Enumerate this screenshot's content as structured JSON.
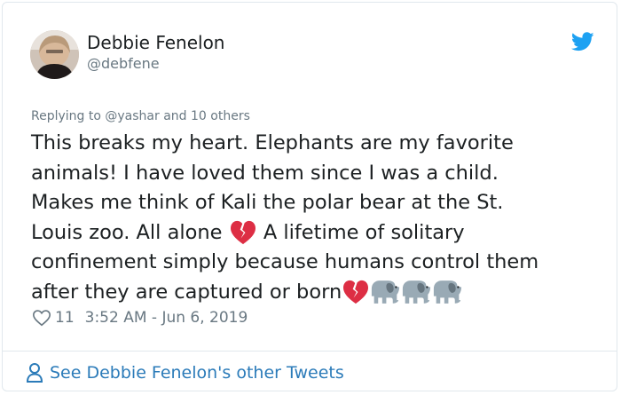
{
  "author": {
    "name": "Debbie Fenelon",
    "handle": "@debfene"
  },
  "reply": {
    "prefix": "Replying to",
    "mention": "@yashar",
    "suffix": "and 10 others"
  },
  "tweet": {
    "line1": "This breaks my heart. Elephants are my favorite",
    "line2": "animals! I have loved them since I was a child.",
    "line3": "Makes me think of Kali the polar bear at the St.",
    "line4a": "Louis zoo. All alone",
    "line4b": "A lifetime of solitary",
    "line5": "confinement simply because humans control them",
    "line6": "after they are captured or born"
  },
  "meta": {
    "likes": "11",
    "timestamp": "3:52 AM - Jun 6, 2019"
  },
  "footer": {
    "see_more": "See Debbie Fenelon's other Tweets"
  },
  "colors": {
    "text": "#1c2022",
    "muted": "#697882",
    "link": "#2b7bb9",
    "twitter_blue": "#1da1f2",
    "broken_heart": "#dd2e44",
    "elephant": "#99aab5"
  },
  "icons": [
    "twitter-bird-icon",
    "broken-heart-icon",
    "elephant-icon",
    "heart-outline-icon",
    "person-icon"
  ]
}
